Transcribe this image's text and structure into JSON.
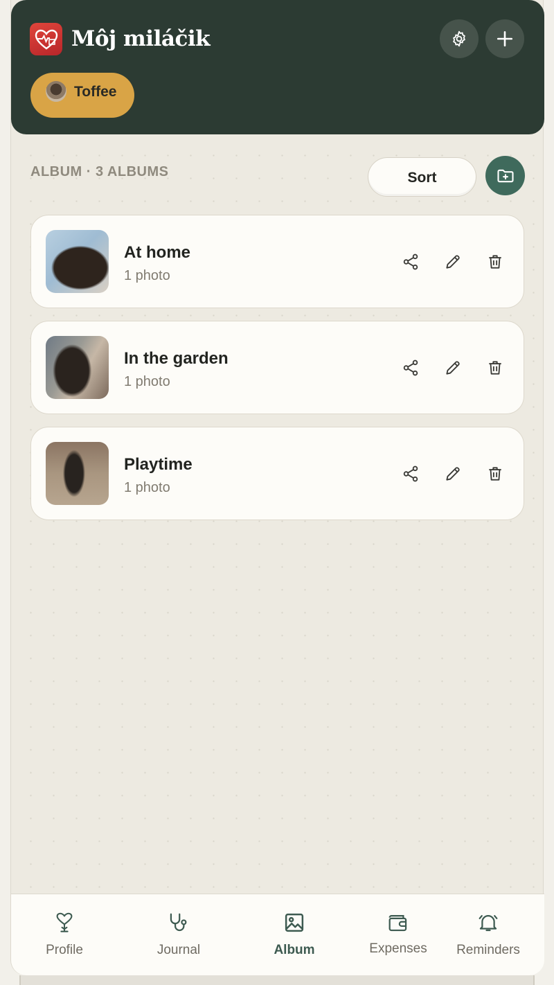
{
  "app": {
    "title": "Môj miláčik"
  },
  "header": {
    "settings_icon": "gear-icon",
    "add_icon": "plus-icon",
    "active_pet": {
      "name": "Toffee"
    }
  },
  "album_section": {
    "label": "ALBUM · 3 ALBUMS",
    "sort_label": "Sort",
    "new_album_icon": "folder-plus-icon"
  },
  "albums": [
    {
      "title": "At home",
      "count": "1 photo"
    },
    {
      "title": "In the garden",
      "count": "1 photo"
    },
    {
      "title": "Playtime",
      "count": "1 photo"
    }
  ],
  "nav": {
    "items": [
      {
        "label": "Profile",
        "icon": "pet-heart-icon"
      },
      {
        "label": "Journal",
        "icon": "stethoscope-icon"
      },
      {
        "label": "Album",
        "icon": "image-icon",
        "active": true
      },
      {
        "label": "Expenses",
        "icon": "wallet-icon"
      },
      {
        "label": "Reminders",
        "icon": "bell-icon"
      }
    ]
  },
  "colors": {
    "header_bg": "#2c3b33",
    "pet_chip": "#d9a446",
    "accent": "#3f6a5c",
    "logo_red": "#d23a33"
  }
}
